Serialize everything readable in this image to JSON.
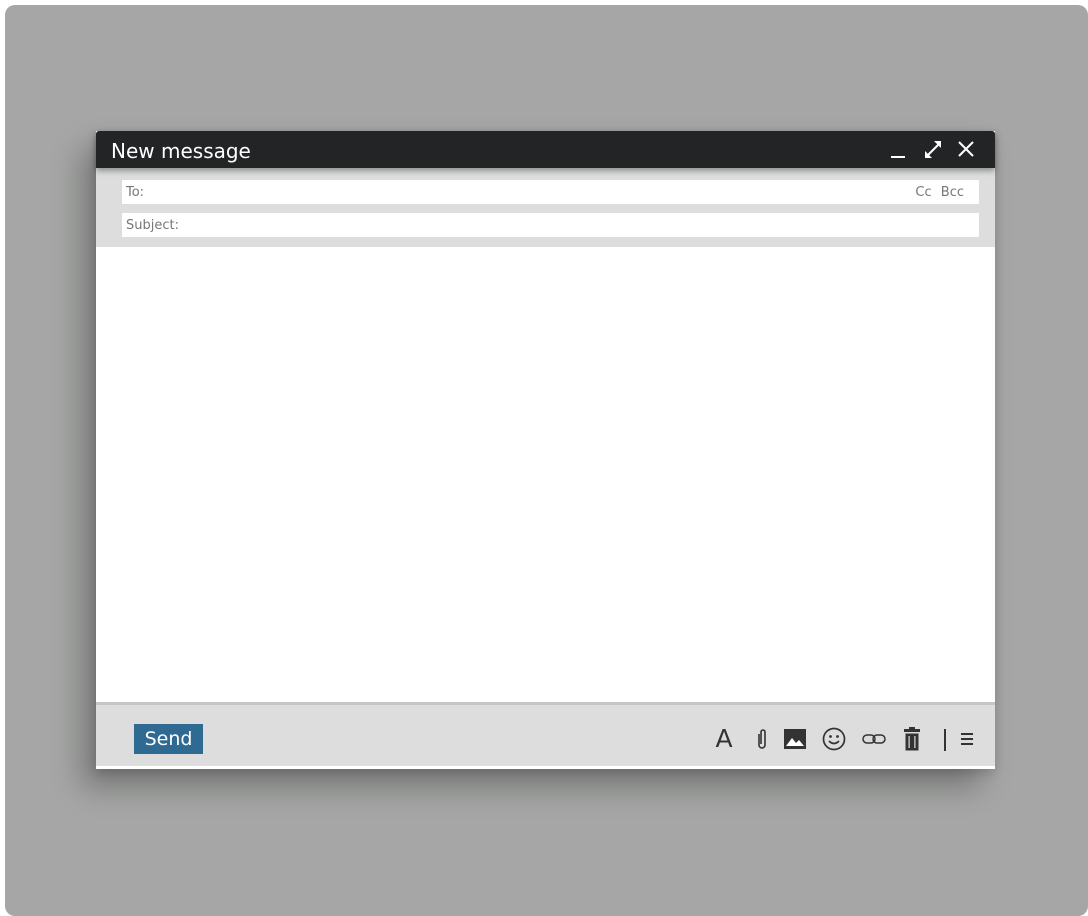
{
  "window": {
    "title": "New message",
    "controls": {
      "minimize_icon": "minimize-icon",
      "expand_icon": "expand-icon",
      "close_icon": "close-icon"
    }
  },
  "fields": {
    "to_label": "To:",
    "to_value": "",
    "subject_label": "Subject:",
    "subject_value": "",
    "cc_label": "Cc",
    "bcc_label": "Bcc"
  },
  "body": {
    "value": ""
  },
  "toolbar": {
    "send_label": "Send",
    "format_label": "A",
    "tools": [
      "format-text-icon",
      "attachment-icon",
      "image-icon",
      "emoji-icon",
      "link-icon",
      "trash-icon",
      "more-options-icon"
    ]
  },
  "colors": {
    "backdrop": "#a5a6a5",
    "titlebar": "#232426",
    "panel": "#dcdddc",
    "send_button": "#2f6a93"
  }
}
